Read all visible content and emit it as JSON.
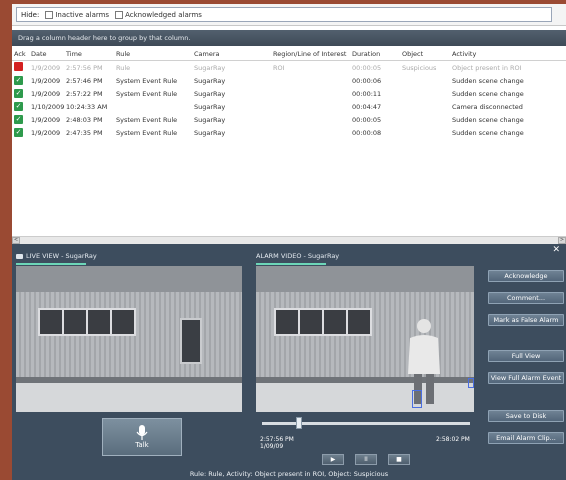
{
  "filter": {
    "hide_label": "Hide:",
    "inactive_label": "Inactive alarms",
    "acknowledged_label": "Acknowledged alarms"
  },
  "group_hint": "Drag a column header here to group by that column.",
  "columns": [
    "Ack",
    "Date",
    "Time",
    "Rule",
    "Camera",
    "Region/Line of Interest",
    "Duration",
    "Object",
    "Activity"
  ],
  "rows": [
    {
      "ack": "red",
      "date": "1/9/2009",
      "time": "2:57:56 PM",
      "rule": "Rule",
      "camera": "SugarRay",
      "region": "ROI",
      "duration": "00:00:05",
      "object": "Suspicious",
      "activity": "Object present in ROI",
      "dim": true
    },
    {
      "ack": "green",
      "date": "1/9/2009",
      "time": "2:57:46 PM",
      "rule": "System Event Rule",
      "camera": "SugarRay",
      "region": "",
      "duration": "00:00:06",
      "object": "",
      "activity": "Sudden scene change",
      "dim": false
    },
    {
      "ack": "green",
      "date": "1/9/2009",
      "time": "2:57:22 PM",
      "rule": "System Event Rule",
      "camera": "SugarRay",
      "region": "",
      "duration": "00:00:11",
      "object": "",
      "activity": "Sudden scene change",
      "dim": false
    },
    {
      "ack": "green",
      "date": "1/10/2009",
      "time": "10:24:33 AM",
      "rule": "",
      "camera": "SugarRay",
      "region": "",
      "duration": "00:04:47",
      "object": "",
      "activity": "Camera disconnected",
      "dim": false
    },
    {
      "ack": "green",
      "date": "1/9/2009",
      "time": "2:48:03 PM",
      "rule": "System Event Rule",
      "camera": "SugarRay",
      "region": "",
      "duration": "00:00:05",
      "object": "",
      "activity": "Sudden scene change",
      "dim": false
    },
    {
      "ack": "green",
      "date": "1/9/2009",
      "time": "2:47:35 PM",
      "rule": "System Event Rule",
      "camera": "SugarRay",
      "region": "",
      "duration": "00:00:08",
      "object": "",
      "activity": "Sudden scene change",
      "dim": false
    }
  ],
  "live_view": {
    "title": "LIVE VIEW - SugarRay"
  },
  "alarm_video": {
    "title": "ALARM VIDEO - SugarRay",
    "start_time": "2:57:56 PM",
    "start_date": "1/09/09",
    "end_time": "2:58:02 PM",
    "position": 0.18
  },
  "talk_label": "Talk",
  "actions": {
    "acknowledge": "Acknowledge",
    "comment": "Comment...",
    "false_alarm": "Mark as False Alarm",
    "full_view": "Full View",
    "full_alarm_event": "View Full Alarm Event",
    "save_to_disk": "Save to Disk",
    "email_clip": "Email Alarm Clip..."
  },
  "playback": {
    "play": "▶",
    "pause": "II",
    "stop": "■"
  },
  "status": "Rule: Rule, Activity: Object present in ROI, Object: Suspicious",
  "colors": {
    "ack_red": "#d42020",
    "ack_green": "#2e9a4c",
    "panel_bg": "#3d4d5e",
    "accent": "#6cd6b8"
  }
}
